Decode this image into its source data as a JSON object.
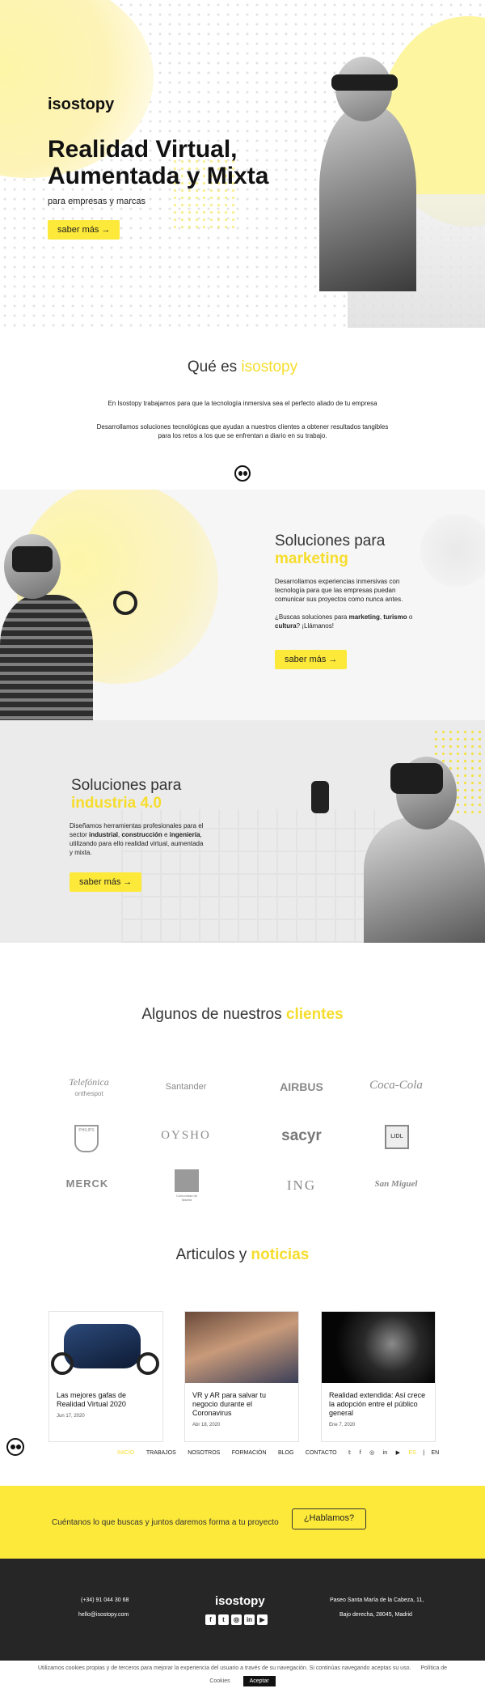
{
  "hero": {
    "logo": "isostopy",
    "title_line1": "Realidad Virtual,",
    "title_line2": "Aumentada y Mixta",
    "subtitle": "para empresas y marcas",
    "cta": "saber más →"
  },
  "about": {
    "title_a": "Qué es",
    "title_b": "isostopy",
    "p1": "En Isostopy trabajamos para que la tecnología inmersiva sea el perfecto aliado de tu empresa",
    "p2a": "Desarrollamos soluciones tecnológicas que ayudan a nuestros clientes a obtener resultados tangibles",
    "p2b": "para los retos a los que se enfrentan a diario en su trabajo."
  },
  "marketing": {
    "title_a": "Soluciones para",
    "title_b": "marketing",
    "p1": "Desarrollamos experiencias inmersivas con tecnología para que las empresas puedan comunicar sus proyectos como nunca antes.",
    "p2_pre": "¿Buscas soluciones para ",
    "p2_b1": "marketing",
    "p2_mid": ", ",
    "p2_b2": "turismo",
    "p2_mid2": " o ",
    "p2_b3": "cultura",
    "p2_post": "? ¡Llámanos!",
    "cta": "saber más →"
  },
  "industria": {
    "title_a": "Soluciones para",
    "title_b": "industria 4.0",
    "p_pre": "Diseñamos herramientas profesionales para el sector ",
    "b1": "industrial",
    "sep": ", ",
    "b2": "construcción",
    "and": " e ",
    "b3": "ingeniería",
    "p_post": ", utilizando para ello realidad virtual, aumentada y mixta.",
    "cta": "saber más →"
  },
  "clients": {
    "title_a": "Algunos de nuestros",
    "title_b": "clientes",
    "logos": [
      "Telefónica",
      "Santander",
      "AIRBUS",
      "Coca-Cola",
      "PHILIPS",
      "OYSHO",
      "sacyr",
      "LIDL",
      "MERCK",
      "Comunidad de Madrid",
      "ING",
      "San Miguel"
    ],
    "telefonica_sub": "onthespot"
  },
  "articles": {
    "title_a": "Articulos y",
    "title_b": "noticias",
    "items": [
      {
        "title": "Las mejores gafas de Realidad Virtual 2020",
        "date": "Jun 17, 2020"
      },
      {
        "title": "VR y AR para salvar tu negocio durante el Coronavirus",
        "date": "Abr 18, 2020"
      },
      {
        "title": "Realidad extendida: Así crece la adopción entre el público general",
        "date": "Ene 7, 2020"
      }
    ]
  },
  "nav": {
    "items": [
      "INICIO",
      "TRABAJOS",
      "NOSOTROS",
      "FORMACIÓN",
      "BLOG",
      "CONTACTO"
    ],
    "lang_es": "ES",
    "lang_en": "EN"
  },
  "cta_band": {
    "text": "Cuéntanos lo que buscas y juntos daremos forma a tu proyecto",
    "button": "¿Hablamos?"
  },
  "footer": {
    "phone": "(+34) 91 044 30 68",
    "email": "hello@isostopy.com",
    "logo": "isostopy",
    "addr1": "Paseo Santa María de la Cabeza, 11,",
    "addr2": "Bajo derecha, 28045, Madrid"
  },
  "cookies": {
    "text": "Utilizamos cookies propias y de terceros para mejorar la experiencia del usuario a través de su navegación. Si continúas navegando aceptas su uso.",
    "policy": "Política de",
    "policy2": "Cookies",
    "accept": "Aceptar"
  },
  "colors": {
    "accent": "#fde93a",
    "dark": "#262626"
  }
}
